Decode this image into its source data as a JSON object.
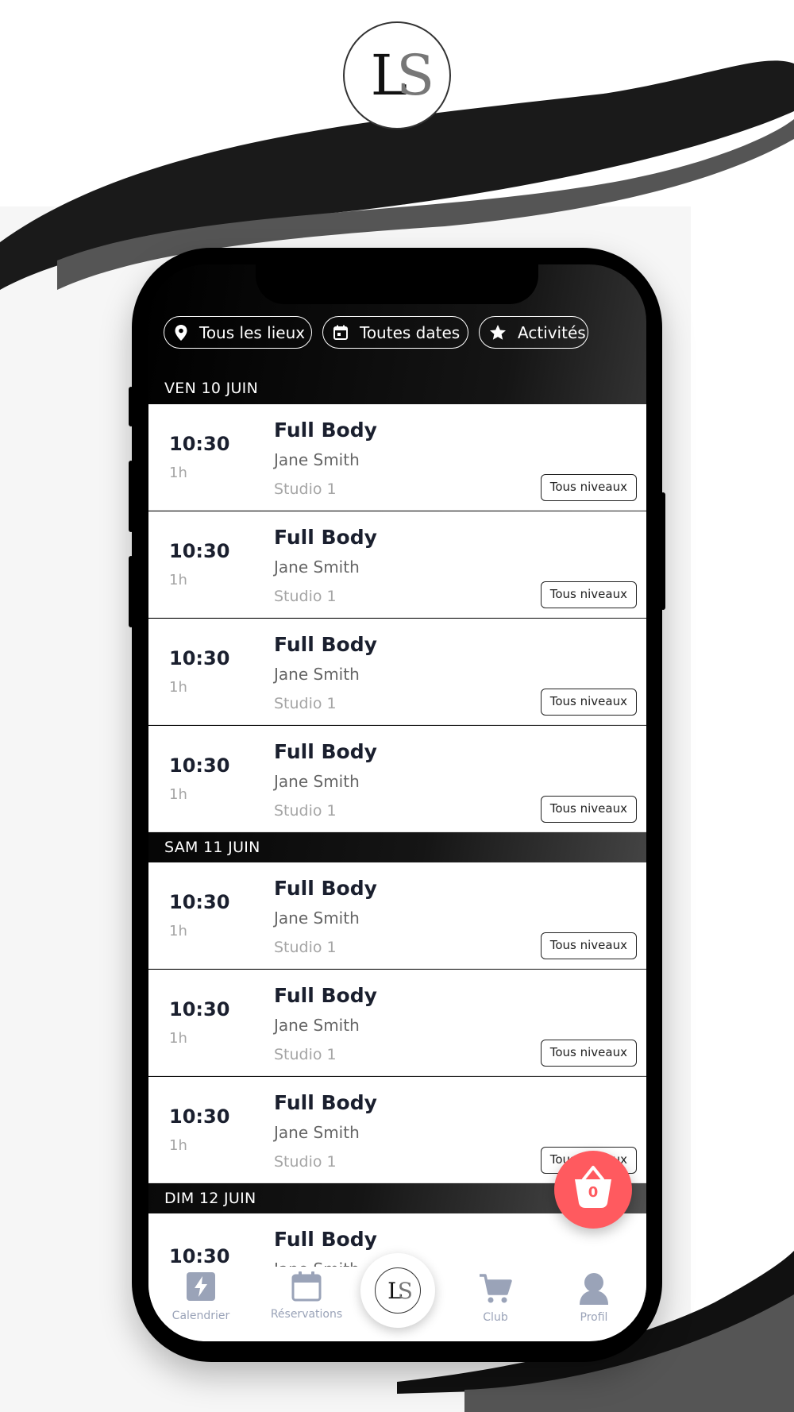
{
  "brand": {
    "logo_left": "L",
    "logo_right": "S",
    "accent_color": "#ff5a5f",
    "text_dark": "#1a1f2e"
  },
  "filters": [
    {
      "label": "Tous les lieux",
      "icon": "location-pin-icon"
    },
    {
      "label": "Toutes dates",
      "icon": "calendar-icon"
    },
    {
      "label": "Activités",
      "icon": "star-icon"
    }
  ],
  "days": [
    {
      "label": "VEN 10 JUIN"
    },
    {
      "label": "SAM 11 JUIN"
    },
    {
      "label": "DIM 12 JUIN"
    }
  ],
  "sessions": [
    {
      "time": "10:30",
      "duration": "1h",
      "title": "Full Body",
      "coach": "Jane Smith",
      "room": "Studio 1",
      "level": "Tous niveaux"
    },
    {
      "time": "10:30",
      "duration": "1h",
      "title": "Full Body",
      "coach": "Jane Smith",
      "room": "Studio 1",
      "level": "Tous niveaux"
    },
    {
      "time": "10:30",
      "duration": "1h",
      "title": "Full Body",
      "coach": "Jane Smith",
      "room": "Studio 1",
      "level": "Tous niveaux"
    },
    {
      "time": "10:30",
      "duration": "1h",
      "title": "Full Body",
      "coach": "Jane Smith",
      "room": "Studio 1",
      "level": "Tous niveaux"
    },
    {
      "time": "10:30",
      "duration": "1h",
      "title": "Full Body",
      "coach": "Jane Smith",
      "room": "Studio 1",
      "level": "Tous niveaux"
    },
    {
      "time": "10:30",
      "duration": "1h",
      "title": "Full Body",
      "coach": "Jane Smith",
      "room": "Studio 1",
      "level": "Tous niveaux"
    },
    {
      "time": "10:30",
      "duration": "1h",
      "title": "Full Body",
      "coach": "Jane Smith",
      "room": "Studio 1",
      "level": "Tous niveaux"
    },
    {
      "time": "10:30",
      "title": "Full Body",
      "coach": "Jane Smith"
    }
  ],
  "cart": {
    "count": "0"
  },
  "nav": {
    "calendar": "Calendrier",
    "reservations": "Réservations",
    "club": "Club",
    "profile": "Profil"
  }
}
